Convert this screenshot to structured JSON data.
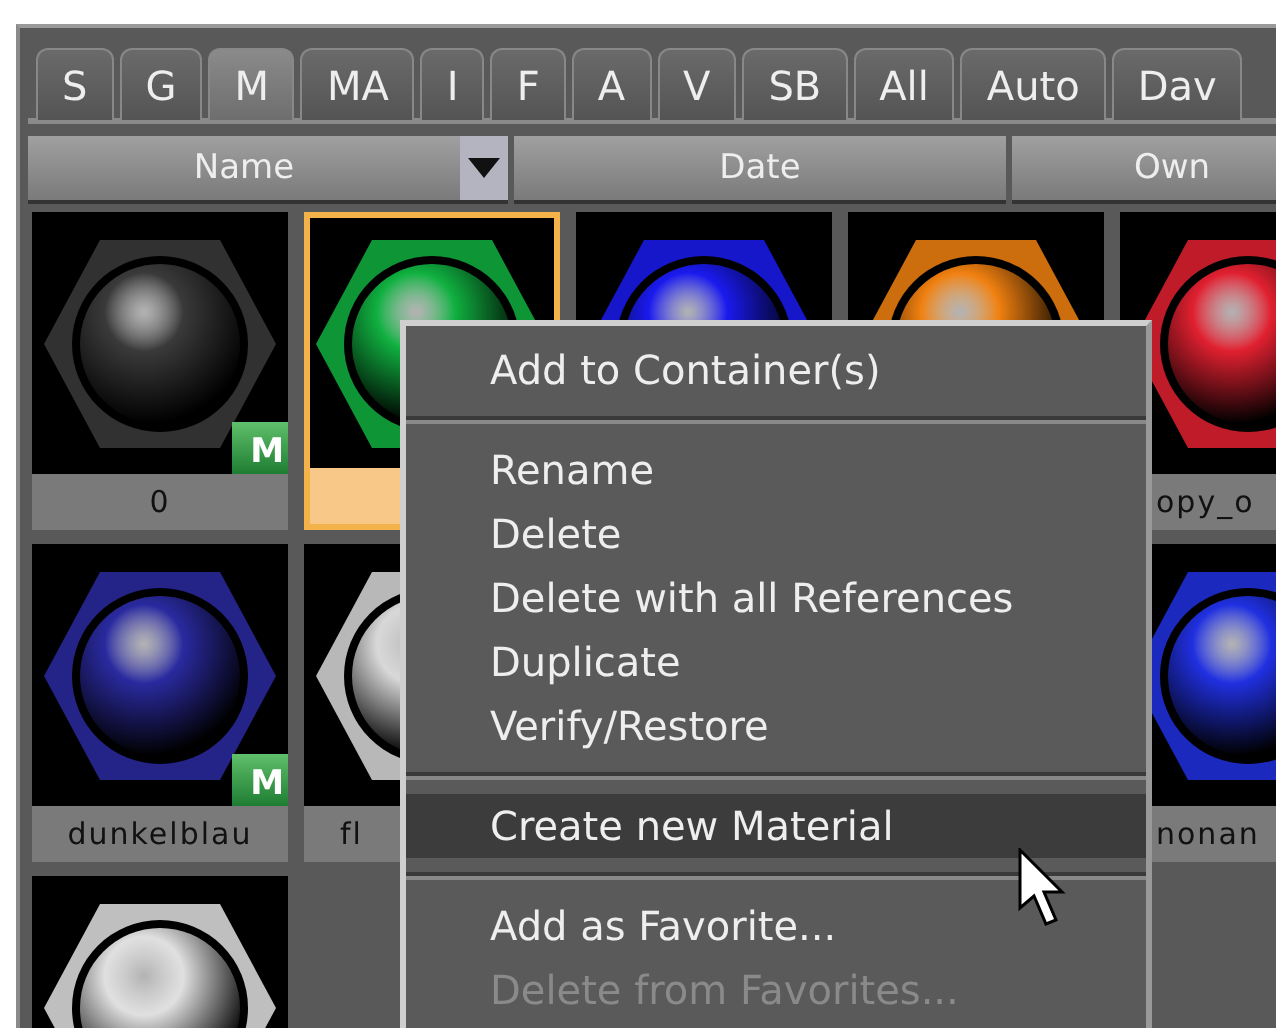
{
  "tabs": [
    {
      "label": "S",
      "selected": false
    },
    {
      "label": "G",
      "selected": false
    },
    {
      "label": "M",
      "selected": true
    },
    {
      "label": "MA",
      "selected": false
    },
    {
      "label": "I",
      "selected": false
    },
    {
      "label": "F",
      "selected": false
    },
    {
      "label": "A",
      "selected": false
    },
    {
      "label": "V",
      "selected": false
    },
    {
      "label": "SB",
      "selected": false
    },
    {
      "label": "All",
      "selected": false
    },
    {
      "label": "Auto",
      "selected": false
    },
    {
      "label": "Dav",
      "selected": false
    }
  ],
  "columns": [
    {
      "label": "Name",
      "sort_menu": true
    },
    {
      "label": "Date",
      "sort_menu": false
    },
    {
      "label": "Own",
      "sort_menu": false
    }
  ],
  "tiles": [
    {
      "kind": "material",
      "name": "0",
      "name_cut": false,
      "color": "#3a3a3a",
      "badge": "M",
      "selected": false
    },
    {
      "kind": "material",
      "color": "#10b040",
      "selected": true
    },
    {
      "kind": "material",
      "color": "#1a1aee",
      "selected": false
    },
    {
      "kind": "material",
      "color": "#f08010",
      "selected": false
    },
    {
      "kind": "material",
      "name": "opy_o",
      "name_cut": true,
      "color": "#e02030",
      "selected": false
    },
    {
      "kind": "material",
      "name": "dunkelblau",
      "name_cut": false,
      "color": "#2a2aa0",
      "badge": "M",
      "selected": false
    },
    {
      "kind": "material",
      "name": "fl",
      "name_cut": true,
      "color": "#d8d8d8",
      "selected": false
    },
    {
      "kind": "covered"
    },
    {
      "kind": "covered"
    },
    {
      "kind": "material",
      "name": "nonan",
      "name_cut": true,
      "color": "#2030e0",
      "selected": false
    },
    {
      "kind": "material",
      "color": "#e0e0e0",
      "selected": false
    }
  ],
  "context_menu": [
    {
      "kind": "item",
      "label": "Add to Container(s)",
      "highlighted": false,
      "disabled": false
    },
    {
      "kind": "separator"
    },
    {
      "kind": "item",
      "label": "Rename",
      "highlighted": false,
      "disabled": false
    },
    {
      "kind": "item",
      "label": "Delete",
      "highlighted": false,
      "disabled": false
    },
    {
      "kind": "item",
      "label": "Delete with all References",
      "highlighted": false,
      "disabled": false
    },
    {
      "kind": "item",
      "label": "Duplicate",
      "highlighted": false,
      "disabled": false
    },
    {
      "kind": "item",
      "label": "Verify/Restore",
      "highlighted": false,
      "disabled": false
    },
    {
      "kind": "separator"
    },
    {
      "kind": "item",
      "label": "Create new Material",
      "highlighted": true,
      "disabled": false
    },
    {
      "kind": "separator"
    },
    {
      "kind": "item",
      "label": "Add as Favorite...",
      "highlighted": false,
      "disabled": false
    },
    {
      "kind": "item",
      "label": "Delete from Favorites...",
      "highlighted": false,
      "disabled": true
    }
  ]
}
